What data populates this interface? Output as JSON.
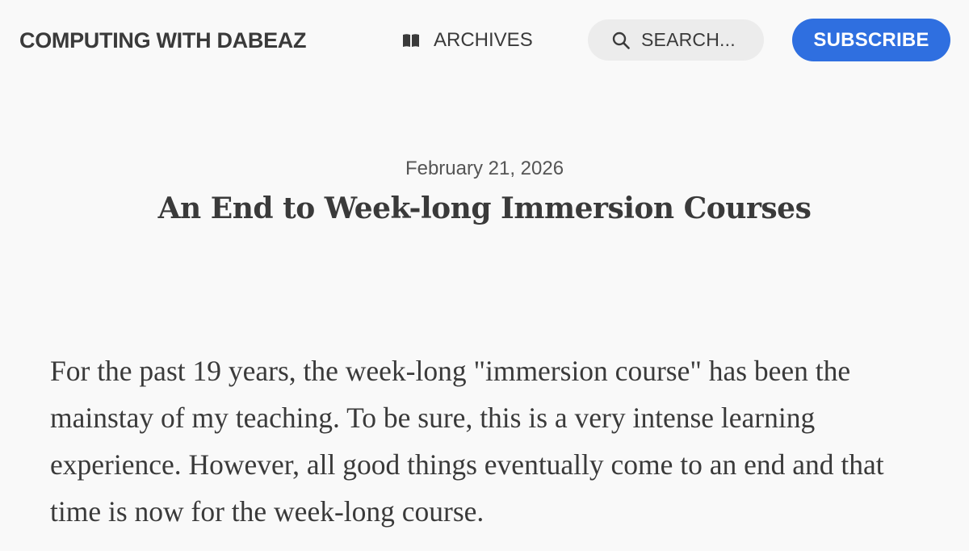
{
  "header": {
    "site_title": "COMPUTING WITH DABEAZ",
    "nav": {
      "archives_label": "ARCHIVES",
      "archives_icon": "book-icon"
    },
    "search": {
      "label": "SEARCH...",
      "icon": "search-icon"
    },
    "subscribe_label": "SUBSCRIBE"
  },
  "post": {
    "date": "February 21, 2026",
    "title": "An End to Week-long Immersion Courses",
    "body": "For the past 19 years, the week-long \"immersion course\" has been the mainstay of my teaching. To be sure, this is a very intense learning experience. However, all good things eventually come to an end and that time is now for the week-long course."
  },
  "colors": {
    "background": "#f9f9f9",
    "text": "#3a3a3a",
    "muted_text": "#555555",
    "search_pill": "#ececec",
    "accent": "#2f6fe0"
  }
}
